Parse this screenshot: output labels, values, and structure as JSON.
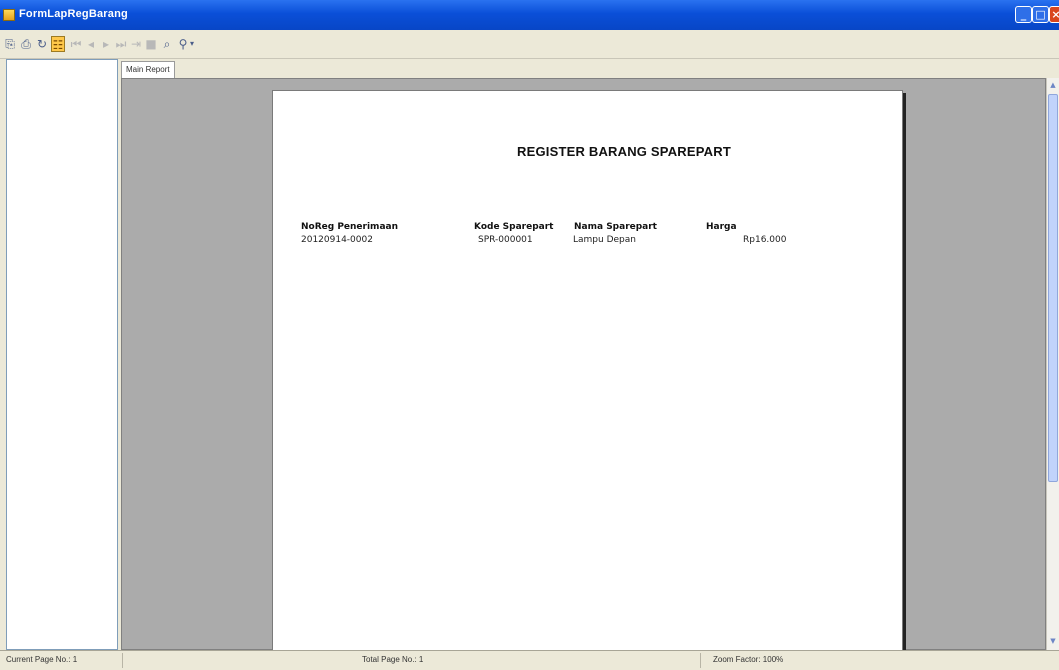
{
  "window": {
    "title": "FormLapRegBarang"
  },
  "toolbar": {
    "buttons": [
      {
        "icon": "export-icon",
        "glyph": "⎘"
      },
      {
        "icon": "print-icon",
        "glyph": "⎙"
      },
      {
        "icon": "refresh-icon",
        "glyph": "↻"
      },
      {
        "icon": "group-tree-icon",
        "glyph": "☷"
      },
      {
        "icon": "first-page-icon",
        "glyph": "⏮"
      },
      {
        "icon": "previous-page-icon",
        "glyph": "◂"
      },
      {
        "icon": "next-page-icon",
        "glyph": "▸"
      },
      {
        "icon": "last-page-icon",
        "glyph": "⏭"
      },
      {
        "icon": "goto-page-icon",
        "glyph": "⇥"
      },
      {
        "icon": "stop-icon",
        "glyph": "■"
      },
      {
        "icon": "search-icon",
        "glyph": "⌕"
      },
      {
        "icon": "zoom-icon",
        "glyph": "⚲"
      }
    ]
  },
  "tab": {
    "label": "Main Report"
  },
  "report": {
    "title": "REGISTER BARANG SPAREPART",
    "columns": [
      "NoReg Penerimaan",
      "Kode Sparepart",
      "Nama Sparepart",
      "Harga"
    ],
    "rows": [
      [
        "20120914-0002",
        "SPR-000001",
        "Lampu Depan",
        "Rp16.000"
      ]
    ]
  },
  "status": {
    "current_page": "Current Page No.: 1",
    "total_page": "Total Page No.: 1",
    "zoom": "Zoom Factor: 100%"
  },
  "colors": {
    "titlebar": "#0a4fd8",
    "viewer_bg": "#ababab",
    "window_bg": "#ece9d8"
  }
}
